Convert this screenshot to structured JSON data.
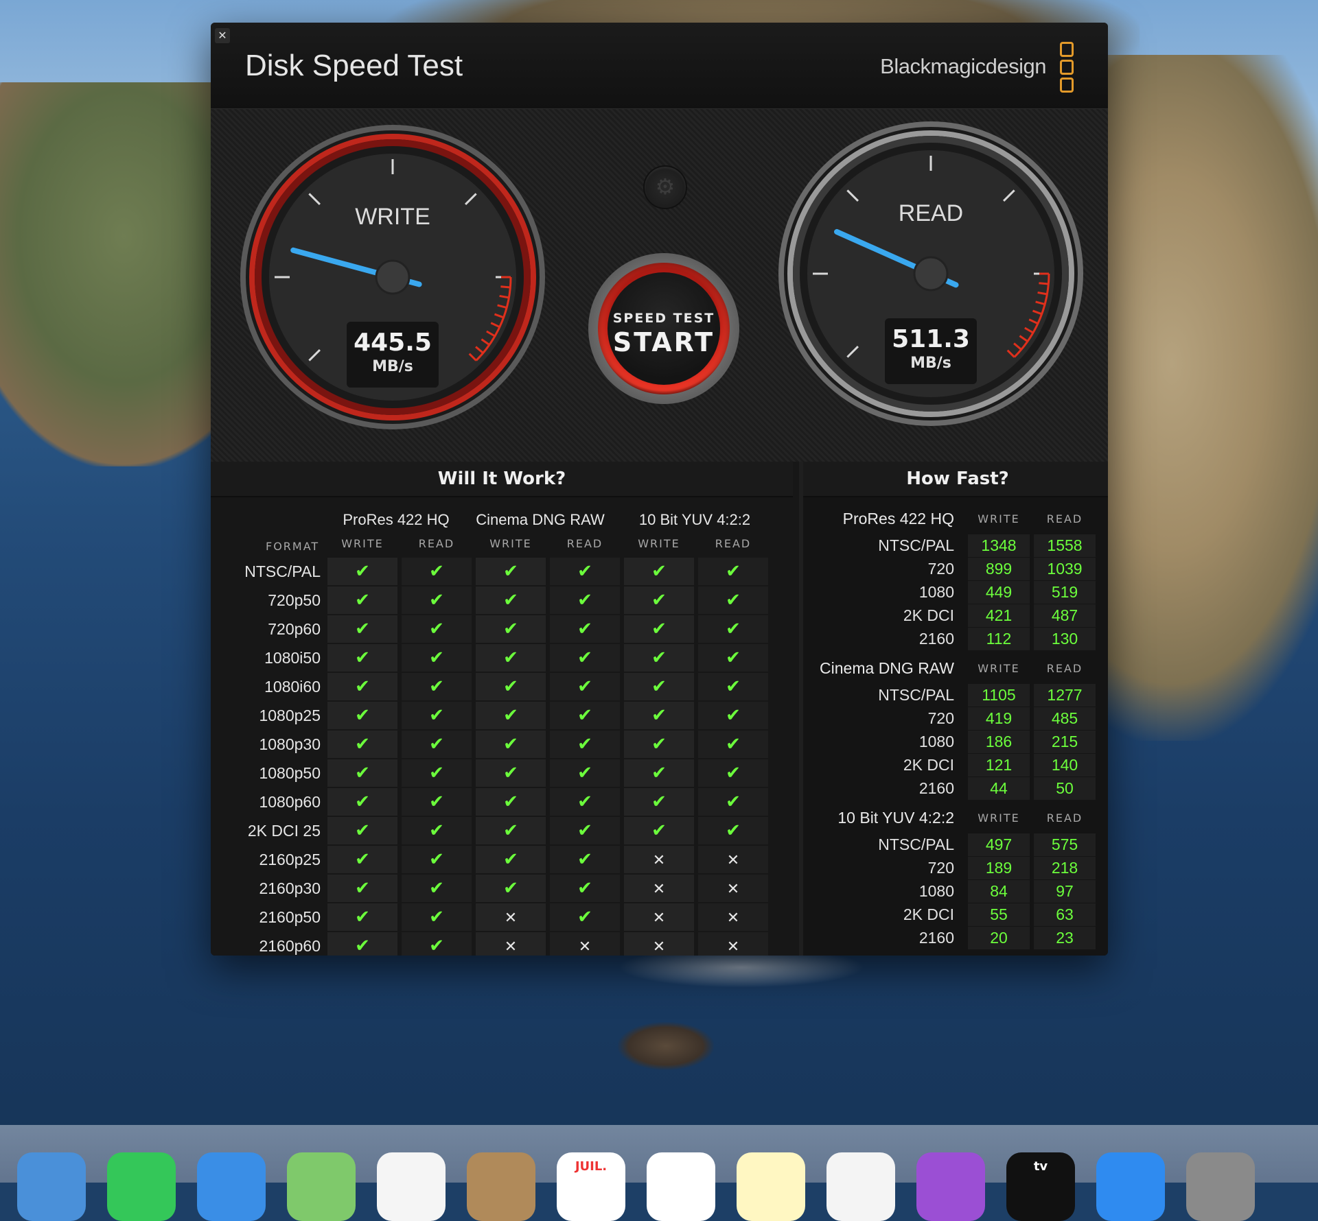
{
  "app": {
    "title": "Disk Speed Test",
    "brand": "Blackmagicdesign",
    "close_glyph": "✕",
    "accent_color": "#e39a2a",
    "ok_color": "#6cff3c"
  },
  "gauges": {
    "write": {
      "label": "WRITE",
      "value": "445.5",
      "unit": "MB/s"
    },
    "read": {
      "label": "READ",
      "value": "511.3",
      "unit": "MB/s"
    }
  },
  "start_button": {
    "top_label": "SPEED TEST",
    "main_label": "START"
  },
  "settings_icon": "gear-icon",
  "will_it_work": {
    "title": "Will It Work?",
    "format_header": "FORMAT",
    "groups": [
      {
        "name": "ProRes 422 HQ",
        "write": "WRITE",
        "read": "READ"
      },
      {
        "name": "Cinema DNG RAW",
        "write": "WRITE",
        "read": "READ"
      },
      {
        "name": "10 Bit YUV 4:2:2",
        "write": "WRITE",
        "read": "READ"
      }
    ],
    "rows": [
      {
        "format": "NTSC/PAL",
        "cells": [
          1,
          1,
          1,
          1,
          1,
          1
        ]
      },
      {
        "format": "720p50",
        "cells": [
          1,
          1,
          1,
          1,
          1,
          1
        ]
      },
      {
        "format": "720p60",
        "cells": [
          1,
          1,
          1,
          1,
          1,
          1
        ]
      },
      {
        "format": "1080i50",
        "cells": [
          1,
          1,
          1,
          1,
          1,
          1
        ]
      },
      {
        "format": "1080i60",
        "cells": [
          1,
          1,
          1,
          1,
          1,
          1
        ]
      },
      {
        "format": "1080p25",
        "cells": [
          1,
          1,
          1,
          1,
          1,
          1
        ]
      },
      {
        "format": "1080p30",
        "cells": [
          1,
          1,
          1,
          1,
          1,
          1
        ]
      },
      {
        "format": "1080p50",
        "cells": [
          1,
          1,
          1,
          1,
          1,
          1
        ]
      },
      {
        "format": "1080p60",
        "cells": [
          1,
          1,
          1,
          1,
          1,
          1
        ]
      },
      {
        "format": "2K DCI 25",
        "cells": [
          1,
          1,
          1,
          1,
          1,
          1
        ]
      },
      {
        "format": "2160p25",
        "cells": [
          1,
          1,
          1,
          1,
          0,
          0
        ]
      },
      {
        "format": "2160p30",
        "cells": [
          1,
          1,
          1,
          1,
          0,
          0
        ]
      },
      {
        "format": "2160p50",
        "cells": [
          1,
          1,
          0,
          1,
          0,
          0
        ]
      },
      {
        "format": "2160p60",
        "cells": [
          1,
          1,
          0,
          0,
          0,
          0
        ]
      }
    ],
    "ok_glyph": "✔",
    "no_glyph": "✕"
  },
  "how_fast": {
    "title": "How Fast?",
    "groups": [
      {
        "name": "ProRes 422 HQ",
        "write": "WRITE",
        "read": "READ",
        "rows": [
          {
            "label": "NTSC/PAL",
            "write": "1348",
            "read": "1558"
          },
          {
            "label": "720",
            "write": "899",
            "read": "1039"
          },
          {
            "label": "1080",
            "write": "449",
            "read": "519"
          },
          {
            "label": "2K DCI",
            "write": "421",
            "read": "487"
          },
          {
            "label": "2160",
            "write": "112",
            "read": "130"
          }
        ]
      },
      {
        "name": "Cinema DNG RAW",
        "write": "WRITE",
        "read": "READ",
        "rows": [
          {
            "label": "NTSC/PAL",
            "write": "1105",
            "read": "1277"
          },
          {
            "label": "720",
            "write": "419",
            "read": "485"
          },
          {
            "label": "1080",
            "write": "186",
            "read": "215"
          },
          {
            "label": "2K DCI",
            "write": "121",
            "read": "140"
          },
          {
            "label": "2160",
            "write": "44",
            "read": "50"
          }
        ]
      },
      {
        "name": "10 Bit YUV 4:2:2",
        "write": "WRITE",
        "read": "READ",
        "rows": [
          {
            "label": "NTSC/PAL",
            "write": "497",
            "read": "575"
          },
          {
            "label": "720",
            "write": "189",
            "read": "218"
          },
          {
            "label": "1080",
            "write": "84",
            "read": "97"
          },
          {
            "label": "2K DCI",
            "write": "55",
            "read": "63"
          },
          {
            "label": "2160",
            "write": "20",
            "read": "23"
          }
        ]
      }
    ]
  },
  "dock": {
    "items": [
      {
        "name": "mail-icon",
        "color": "#4a90d9"
      },
      {
        "name": "facetime-icon",
        "color": "#34c759"
      },
      {
        "name": "safari-icon",
        "color": "#3a8ee6"
      },
      {
        "name": "maps-icon",
        "color": "#7fc96b"
      },
      {
        "name": "photos-icon",
        "color": "#f5f5f5"
      },
      {
        "name": "contacts-icon",
        "color": "#b08a5a"
      },
      {
        "name": "calendar-icon",
        "color": "#ffffff",
        "text": "JUIL."
      },
      {
        "name": "reminders-icon",
        "color": "#ffffff"
      },
      {
        "name": "notes-icon",
        "color": "#fff7c2"
      },
      {
        "name": "music-icon",
        "color": "#f4f4f4"
      },
      {
        "name": "podcasts-icon",
        "color": "#9b4fd4"
      },
      {
        "name": "tv-icon",
        "color": "#111111",
        "text": "tv"
      },
      {
        "name": "app-store-icon",
        "color": "#2f8bf0"
      },
      {
        "name": "system-preferences-icon",
        "color": "#8a8a8a"
      }
    ]
  }
}
